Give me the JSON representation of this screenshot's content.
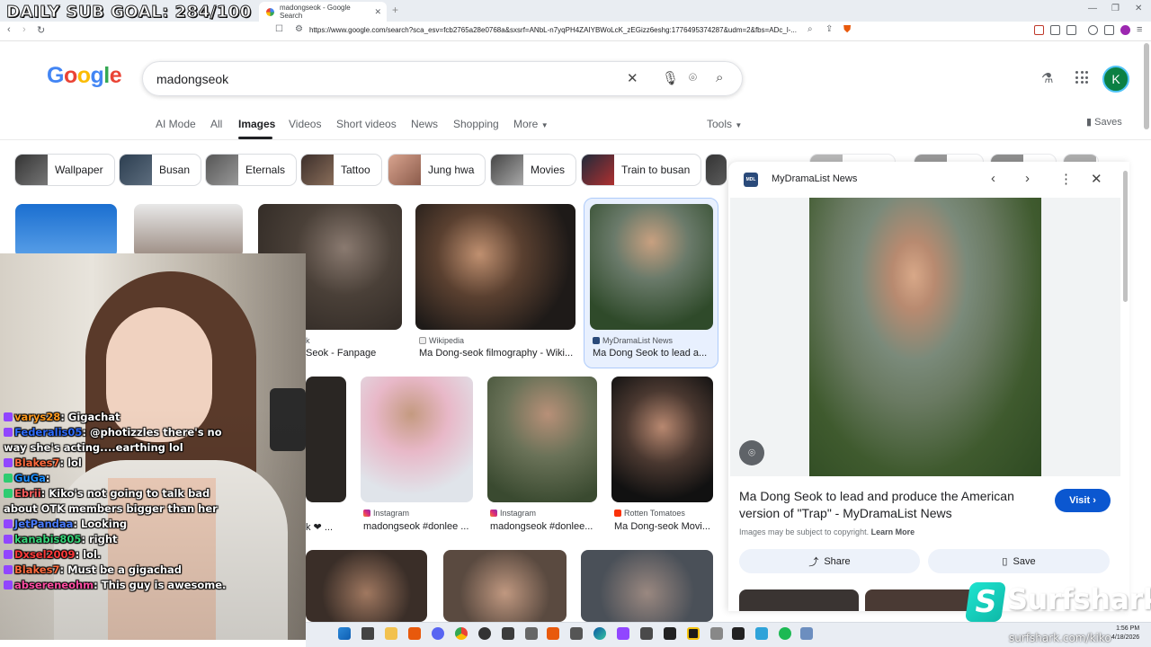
{
  "overlay": {
    "sub_goal": "DAILY SUB GOAL: 284/100"
  },
  "browser": {
    "tab_title": "madongseok - Google Search",
    "url": "https://www.google.com/search?sca_esv=fcb2765a28e0768a&sxsrf=ANbL-n7yqPH4ZAIYBWoLcK_zEGizz6eshg:1776495374287&udm=2&fbs=ADc_l-..."
  },
  "search": {
    "query": "madongseok"
  },
  "avatar_letter": "K",
  "nav_tabs": [
    "AI Mode",
    "All",
    "Images",
    "Videos",
    "Short videos",
    "News",
    "Shopping",
    "More",
    "Tools"
  ],
  "saves_label": "Saves",
  "chips": [
    "Wallpaper",
    "Busan",
    "Eternals",
    "Tattoo",
    "Jung hwa",
    "Movies",
    "Train to busan"
  ],
  "results": [
    {
      "source": "k",
      "title": "Seok - Fanpage"
    },
    {
      "source": "Wikipedia",
      "title": "Ma Dong-seok filmography - Wiki..."
    },
    {
      "source": "MyDramaList News",
      "title": "Ma Dong Seok to lead a..."
    },
    {
      "source": "Instagram",
      "title": "madongseok #donlee ..."
    },
    {
      "source": "Instagram",
      "title": "madongseok #donlee..."
    },
    {
      "source": "Rotten Tomatoes",
      "title": "Ma Dong-seok Movi..."
    },
    {
      "source": "",
      "title": "k ❤ ..."
    }
  ],
  "panel": {
    "source": "MyDramaList News",
    "source_logo": "MDL",
    "title": "Ma Dong Seok to lead and produce the American version of \"Trap\" - MyDramaList News",
    "visit_label": "Visit",
    "disclaimer": "Images may be subject to copyright.",
    "learn_more": "Learn More",
    "share_label": "Share",
    "save_label": "Save"
  },
  "chat": [
    {
      "user": "varys28",
      "color": "#ff9a1f",
      "msg": "Gigachat",
      "badge": "purple"
    },
    {
      "user": "Federalis05",
      "color": "#2e6cff",
      "msg": "@photizzles there's no",
      "badge": "purple"
    },
    {
      "user": "",
      "color": "#fff",
      "msg": "way she's acting....earthing lol",
      "badge": ""
    },
    {
      "user": "Blakes7",
      "color": "#ff6a3d",
      "msg": "lol",
      "badge": "purple"
    },
    {
      "user": "GuGa",
      "color": "#1e90ff",
      "msg": "",
      "badge": "green"
    },
    {
      "user": "Ebrii",
      "color": "#ff5e5e",
      "msg": "Kiko's not going to talk bad",
      "badge": "green"
    },
    {
      "user": "",
      "color": "#fff",
      "msg": "about OTK members bigger than her",
      "badge": ""
    },
    {
      "user": "JetPandaa",
      "color": "#4a7dff",
      "msg": "Looking",
      "badge": "purple"
    },
    {
      "user": "kanabis805",
      "color": "#37d67a",
      "msg": "right",
      "badge": "purple"
    },
    {
      "user": "Dxsel2009",
      "color": "#ff3b3b",
      "msg": "lol.",
      "badge": "purple"
    },
    {
      "user": "Blakes7",
      "color": "#ff6a3d",
      "msg": "Must be a gigachad",
      "badge": "purple"
    },
    {
      "user": "absereneohm",
      "color": "#ff4fa3",
      "msg": "This guy is awesome.",
      "badge": "purple"
    }
  ],
  "clock": {
    "time": "1:56 PM",
    "date": "4/18/2026"
  },
  "sponsor": {
    "name": "Surfshark",
    "url": "surfshark.com/kiko"
  }
}
